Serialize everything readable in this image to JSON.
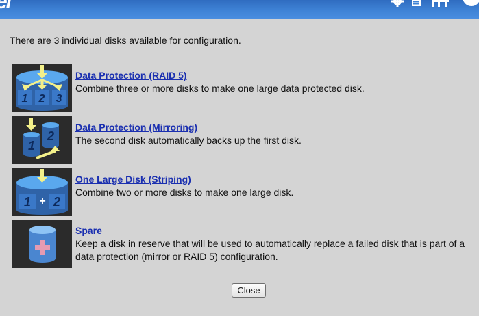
{
  "header": {
    "brand_fragment": "el",
    "icons": [
      "gear-icon",
      "document-icon",
      "network-icon",
      "help-icon"
    ]
  },
  "intro": "There are 3 individual disks available for configuration.",
  "options": [
    {
      "title": "Data Protection (RAID 5)",
      "description": "Combine three or more disks to make one large data protected disk.",
      "icon": "raid5-disks-icon",
      "disk_labels": [
        "1",
        "2",
        "3"
      ]
    },
    {
      "title": "Data Protection (Mirroring)",
      "description": "The second disk automatically backs up the first disk.",
      "icon": "mirroring-disks-icon",
      "disk_labels": [
        "1",
        "2"
      ]
    },
    {
      "title": "One Large Disk (Striping)",
      "description": "Combine two or more disks to make one large disk.",
      "icon": "striping-disks-icon",
      "disk_labels": [
        "1",
        "+",
        "2"
      ]
    },
    {
      "title": "Spare",
      "description": "Keep a disk in reserve that will be used to automatically replace a failed disk that is part of a data protection (mirror or RAID 5) configuration.",
      "icon": "spare-disk-icon",
      "disk_labels": [
        "+"
      ]
    }
  ],
  "close_label": "Close",
  "colors": {
    "background": "#d4d4d4",
    "header_blue": "#3f83d6",
    "link": "#1a2fb0",
    "disk_blue": "#4a86d0",
    "arrow_yellow": "#f3f08a",
    "spare_plus": "#e59bb2"
  }
}
